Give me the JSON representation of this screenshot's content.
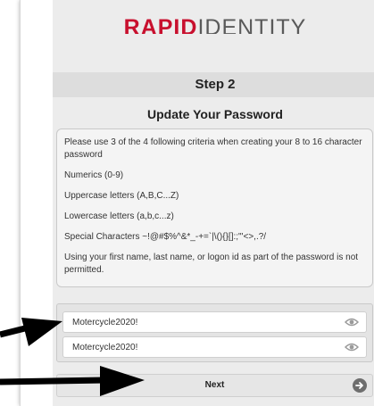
{
  "brand": {
    "part1": "RAPID",
    "part2": "IDENTITY",
    "accent_color": "#c8102e"
  },
  "step_label": "Step 2",
  "form_title": "Update Your Password",
  "criteria": {
    "intro": "Please use 3 of the 4 following criteria when creating your 8 to 16 character password",
    "items": [
      "Numerics (0-9)",
      "Uppercase letters (A,B,C...Z)",
      "Lowercase letters (a,b,c...z)",
      "Special Characters ~!@#$%^&*_-+=`|\\(){}[]:;\"'<>,.?/"
    ],
    "note": "Using your first name, last name, or logon id as part of the password is not permitted."
  },
  "password_fields": [
    {
      "value": "Motercycle2020!",
      "icon": "eye-icon"
    },
    {
      "value": "Motercycle2020!",
      "icon": "eye-icon"
    }
  ],
  "next_button": {
    "label": "Next",
    "icon": "arrow-right-circle-icon"
  },
  "annotation_arrows": {
    "color": "#000000",
    "icon": "arrow-right-icon"
  }
}
